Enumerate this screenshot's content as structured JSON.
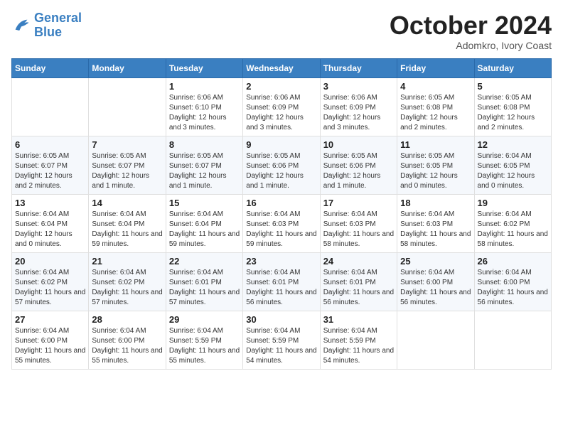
{
  "header": {
    "logo_line1": "General",
    "logo_line2": "Blue",
    "month": "October 2024",
    "location": "Adomkro, Ivory Coast"
  },
  "weekdays": [
    "Sunday",
    "Monday",
    "Tuesday",
    "Wednesday",
    "Thursday",
    "Friday",
    "Saturday"
  ],
  "weeks": [
    [
      {
        "day": "",
        "detail": ""
      },
      {
        "day": "",
        "detail": ""
      },
      {
        "day": "1",
        "detail": "Sunrise: 6:06 AM\nSunset: 6:10 PM\nDaylight: 12 hours and 3 minutes."
      },
      {
        "day": "2",
        "detail": "Sunrise: 6:06 AM\nSunset: 6:09 PM\nDaylight: 12 hours and 3 minutes."
      },
      {
        "day": "3",
        "detail": "Sunrise: 6:06 AM\nSunset: 6:09 PM\nDaylight: 12 hours and 3 minutes."
      },
      {
        "day": "4",
        "detail": "Sunrise: 6:05 AM\nSunset: 6:08 PM\nDaylight: 12 hours and 2 minutes."
      },
      {
        "day": "5",
        "detail": "Sunrise: 6:05 AM\nSunset: 6:08 PM\nDaylight: 12 hours and 2 minutes."
      }
    ],
    [
      {
        "day": "6",
        "detail": "Sunrise: 6:05 AM\nSunset: 6:07 PM\nDaylight: 12 hours and 2 minutes."
      },
      {
        "day": "7",
        "detail": "Sunrise: 6:05 AM\nSunset: 6:07 PM\nDaylight: 12 hours and 1 minute."
      },
      {
        "day": "8",
        "detail": "Sunrise: 6:05 AM\nSunset: 6:07 PM\nDaylight: 12 hours and 1 minute."
      },
      {
        "day": "9",
        "detail": "Sunrise: 6:05 AM\nSunset: 6:06 PM\nDaylight: 12 hours and 1 minute."
      },
      {
        "day": "10",
        "detail": "Sunrise: 6:05 AM\nSunset: 6:06 PM\nDaylight: 12 hours and 1 minute."
      },
      {
        "day": "11",
        "detail": "Sunrise: 6:05 AM\nSunset: 6:05 PM\nDaylight: 12 hours and 0 minutes."
      },
      {
        "day": "12",
        "detail": "Sunrise: 6:04 AM\nSunset: 6:05 PM\nDaylight: 12 hours and 0 minutes."
      }
    ],
    [
      {
        "day": "13",
        "detail": "Sunrise: 6:04 AM\nSunset: 6:04 PM\nDaylight: 12 hours and 0 minutes."
      },
      {
        "day": "14",
        "detail": "Sunrise: 6:04 AM\nSunset: 6:04 PM\nDaylight: 11 hours and 59 minutes."
      },
      {
        "day": "15",
        "detail": "Sunrise: 6:04 AM\nSunset: 6:04 PM\nDaylight: 11 hours and 59 minutes."
      },
      {
        "day": "16",
        "detail": "Sunrise: 6:04 AM\nSunset: 6:03 PM\nDaylight: 11 hours and 59 minutes."
      },
      {
        "day": "17",
        "detail": "Sunrise: 6:04 AM\nSunset: 6:03 PM\nDaylight: 11 hours and 58 minutes."
      },
      {
        "day": "18",
        "detail": "Sunrise: 6:04 AM\nSunset: 6:03 PM\nDaylight: 11 hours and 58 minutes."
      },
      {
        "day": "19",
        "detail": "Sunrise: 6:04 AM\nSunset: 6:02 PM\nDaylight: 11 hours and 58 minutes."
      }
    ],
    [
      {
        "day": "20",
        "detail": "Sunrise: 6:04 AM\nSunset: 6:02 PM\nDaylight: 11 hours and 57 minutes."
      },
      {
        "day": "21",
        "detail": "Sunrise: 6:04 AM\nSunset: 6:02 PM\nDaylight: 11 hours and 57 minutes."
      },
      {
        "day": "22",
        "detail": "Sunrise: 6:04 AM\nSunset: 6:01 PM\nDaylight: 11 hours and 57 minutes."
      },
      {
        "day": "23",
        "detail": "Sunrise: 6:04 AM\nSunset: 6:01 PM\nDaylight: 11 hours and 56 minutes."
      },
      {
        "day": "24",
        "detail": "Sunrise: 6:04 AM\nSunset: 6:01 PM\nDaylight: 11 hours and 56 minutes."
      },
      {
        "day": "25",
        "detail": "Sunrise: 6:04 AM\nSunset: 6:00 PM\nDaylight: 11 hours and 56 minutes."
      },
      {
        "day": "26",
        "detail": "Sunrise: 6:04 AM\nSunset: 6:00 PM\nDaylight: 11 hours and 56 minutes."
      }
    ],
    [
      {
        "day": "27",
        "detail": "Sunrise: 6:04 AM\nSunset: 6:00 PM\nDaylight: 11 hours and 55 minutes."
      },
      {
        "day": "28",
        "detail": "Sunrise: 6:04 AM\nSunset: 6:00 PM\nDaylight: 11 hours and 55 minutes."
      },
      {
        "day": "29",
        "detail": "Sunrise: 6:04 AM\nSunset: 5:59 PM\nDaylight: 11 hours and 55 minutes."
      },
      {
        "day": "30",
        "detail": "Sunrise: 6:04 AM\nSunset: 5:59 PM\nDaylight: 11 hours and 54 minutes."
      },
      {
        "day": "31",
        "detail": "Sunrise: 6:04 AM\nSunset: 5:59 PM\nDaylight: 11 hours and 54 minutes."
      },
      {
        "day": "",
        "detail": ""
      },
      {
        "day": "",
        "detail": ""
      }
    ]
  ]
}
